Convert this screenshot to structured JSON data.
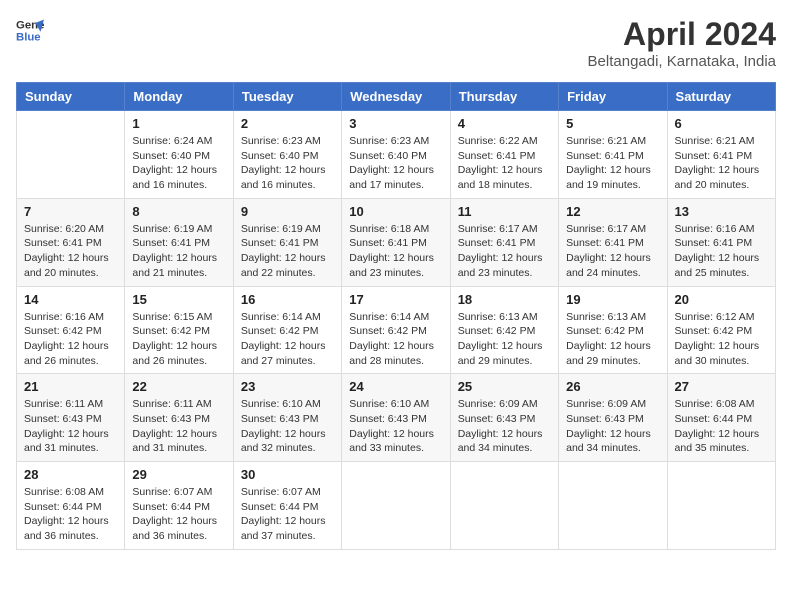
{
  "header": {
    "logo_line1": "General",
    "logo_line2": "Blue",
    "title": "April 2024",
    "subtitle": "Beltangadi, Karnataka, India"
  },
  "columns": [
    "Sunday",
    "Monday",
    "Tuesday",
    "Wednesday",
    "Thursday",
    "Friday",
    "Saturday"
  ],
  "weeks": [
    [
      {
        "day": "",
        "sunrise": "",
        "sunset": "",
        "daylight": ""
      },
      {
        "day": "1",
        "sunrise": "Sunrise: 6:24 AM",
        "sunset": "Sunset: 6:40 PM",
        "daylight": "Daylight: 12 hours and 16 minutes."
      },
      {
        "day": "2",
        "sunrise": "Sunrise: 6:23 AM",
        "sunset": "Sunset: 6:40 PM",
        "daylight": "Daylight: 12 hours and 16 minutes."
      },
      {
        "day": "3",
        "sunrise": "Sunrise: 6:23 AM",
        "sunset": "Sunset: 6:40 PM",
        "daylight": "Daylight: 12 hours and 17 minutes."
      },
      {
        "day": "4",
        "sunrise": "Sunrise: 6:22 AM",
        "sunset": "Sunset: 6:41 PM",
        "daylight": "Daylight: 12 hours and 18 minutes."
      },
      {
        "day": "5",
        "sunrise": "Sunrise: 6:21 AM",
        "sunset": "Sunset: 6:41 PM",
        "daylight": "Daylight: 12 hours and 19 minutes."
      },
      {
        "day": "6",
        "sunrise": "Sunrise: 6:21 AM",
        "sunset": "Sunset: 6:41 PM",
        "daylight": "Daylight: 12 hours and 20 minutes."
      }
    ],
    [
      {
        "day": "7",
        "sunrise": "Sunrise: 6:20 AM",
        "sunset": "Sunset: 6:41 PM",
        "daylight": "Daylight: 12 hours and 20 minutes."
      },
      {
        "day": "8",
        "sunrise": "Sunrise: 6:19 AM",
        "sunset": "Sunset: 6:41 PM",
        "daylight": "Daylight: 12 hours and 21 minutes."
      },
      {
        "day": "9",
        "sunrise": "Sunrise: 6:19 AM",
        "sunset": "Sunset: 6:41 PM",
        "daylight": "Daylight: 12 hours and 22 minutes."
      },
      {
        "day": "10",
        "sunrise": "Sunrise: 6:18 AM",
        "sunset": "Sunset: 6:41 PM",
        "daylight": "Daylight: 12 hours and 23 minutes."
      },
      {
        "day": "11",
        "sunrise": "Sunrise: 6:17 AM",
        "sunset": "Sunset: 6:41 PM",
        "daylight": "Daylight: 12 hours and 23 minutes."
      },
      {
        "day": "12",
        "sunrise": "Sunrise: 6:17 AM",
        "sunset": "Sunset: 6:41 PM",
        "daylight": "Daylight: 12 hours and 24 minutes."
      },
      {
        "day": "13",
        "sunrise": "Sunrise: 6:16 AM",
        "sunset": "Sunset: 6:41 PM",
        "daylight": "Daylight: 12 hours and 25 minutes."
      }
    ],
    [
      {
        "day": "14",
        "sunrise": "Sunrise: 6:16 AM",
        "sunset": "Sunset: 6:42 PM",
        "daylight": "Daylight: 12 hours and 26 minutes."
      },
      {
        "day": "15",
        "sunrise": "Sunrise: 6:15 AM",
        "sunset": "Sunset: 6:42 PM",
        "daylight": "Daylight: 12 hours and 26 minutes."
      },
      {
        "day": "16",
        "sunrise": "Sunrise: 6:14 AM",
        "sunset": "Sunset: 6:42 PM",
        "daylight": "Daylight: 12 hours and 27 minutes."
      },
      {
        "day": "17",
        "sunrise": "Sunrise: 6:14 AM",
        "sunset": "Sunset: 6:42 PM",
        "daylight": "Daylight: 12 hours and 28 minutes."
      },
      {
        "day": "18",
        "sunrise": "Sunrise: 6:13 AM",
        "sunset": "Sunset: 6:42 PM",
        "daylight": "Daylight: 12 hours and 29 minutes."
      },
      {
        "day": "19",
        "sunrise": "Sunrise: 6:13 AM",
        "sunset": "Sunset: 6:42 PM",
        "daylight": "Daylight: 12 hours and 29 minutes."
      },
      {
        "day": "20",
        "sunrise": "Sunrise: 6:12 AM",
        "sunset": "Sunset: 6:42 PM",
        "daylight": "Daylight: 12 hours and 30 minutes."
      }
    ],
    [
      {
        "day": "21",
        "sunrise": "Sunrise: 6:11 AM",
        "sunset": "Sunset: 6:43 PM",
        "daylight": "Daylight: 12 hours and 31 minutes."
      },
      {
        "day": "22",
        "sunrise": "Sunrise: 6:11 AM",
        "sunset": "Sunset: 6:43 PM",
        "daylight": "Daylight: 12 hours and 31 minutes."
      },
      {
        "day": "23",
        "sunrise": "Sunrise: 6:10 AM",
        "sunset": "Sunset: 6:43 PM",
        "daylight": "Daylight: 12 hours and 32 minutes."
      },
      {
        "day": "24",
        "sunrise": "Sunrise: 6:10 AM",
        "sunset": "Sunset: 6:43 PM",
        "daylight": "Daylight: 12 hours and 33 minutes."
      },
      {
        "day": "25",
        "sunrise": "Sunrise: 6:09 AM",
        "sunset": "Sunset: 6:43 PM",
        "daylight": "Daylight: 12 hours and 34 minutes."
      },
      {
        "day": "26",
        "sunrise": "Sunrise: 6:09 AM",
        "sunset": "Sunset: 6:43 PM",
        "daylight": "Daylight: 12 hours and 34 minutes."
      },
      {
        "day": "27",
        "sunrise": "Sunrise: 6:08 AM",
        "sunset": "Sunset: 6:44 PM",
        "daylight": "Daylight: 12 hours and 35 minutes."
      }
    ],
    [
      {
        "day": "28",
        "sunrise": "Sunrise: 6:08 AM",
        "sunset": "Sunset: 6:44 PM",
        "daylight": "Daylight: 12 hours and 36 minutes."
      },
      {
        "day": "29",
        "sunrise": "Sunrise: 6:07 AM",
        "sunset": "Sunset: 6:44 PM",
        "daylight": "Daylight: 12 hours and 36 minutes."
      },
      {
        "day": "30",
        "sunrise": "Sunrise: 6:07 AM",
        "sunset": "Sunset: 6:44 PM",
        "daylight": "Daylight: 12 hours and 37 minutes."
      },
      {
        "day": "",
        "sunrise": "",
        "sunset": "",
        "daylight": ""
      },
      {
        "day": "",
        "sunrise": "",
        "sunset": "",
        "daylight": ""
      },
      {
        "day": "",
        "sunrise": "",
        "sunset": "",
        "daylight": ""
      },
      {
        "day": "",
        "sunrise": "",
        "sunset": "",
        "daylight": ""
      }
    ]
  ]
}
